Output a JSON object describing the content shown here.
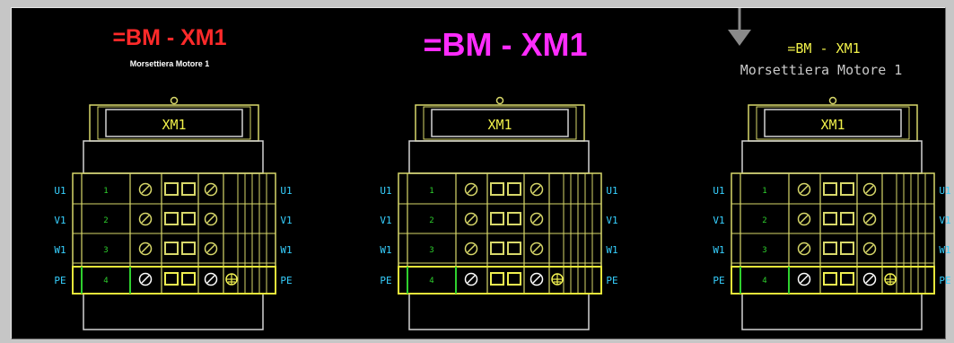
{
  "titles": [
    {
      "main": "=BM - XM1",
      "sub": "Morsettiera Motore 1",
      "main_color": "#ff2a2a",
      "sub_color": "#ffffff"
    },
    {
      "main": "=BM - XM1",
      "main_color": "#ff2cff"
    },
    {
      "main": "=BM - XM1",
      "sub": "Morsettiera Motore 1",
      "main_color": "#f2f24a",
      "sub_color": "#c9c9c9"
    }
  ],
  "panel": {
    "header_label": "XM1",
    "rows": [
      {
        "left": "U1",
        "number": "1",
        "right": "U1"
      },
      {
        "left": "V1",
        "number": "2",
        "right": "V1"
      },
      {
        "left": "W1",
        "number": "3",
        "right": "W1"
      },
      {
        "left": "PE",
        "number": "4",
        "right": "PE"
      }
    ]
  },
  "colors": {
    "background": "#000000",
    "outline": "#d2d2d2",
    "terminal": "#d8d86a",
    "side_label": "#36d0ff",
    "row_number": "#2ed02e",
    "pe_border": "#e6e63a"
  },
  "icons": [
    "screw-icon",
    "clamp-icon",
    "ground-symbol-icon",
    "arrow-down-icon"
  ]
}
